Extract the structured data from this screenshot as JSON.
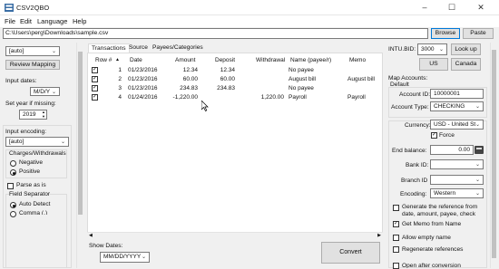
{
  "window": {
    "title": "CSV2QBO"
  },
  "menu": [
    "File",
    "Edit",
    "Language",
    "Help"
  ],
  "file": {
    "path": "C:\\Users\\perg\\Downloads\\sample.csv",
    "browse_label": "Browse",
    "paste_label": "Paste"
  },
  "left": {
    "template_value": "[auto]",
    "review_mapping_label": "Review Mapping",
    "input_dates_label": "Input dates:",
    "date_format_value": "M/D/Y",
    "set_year_label": "Set year if missing:",
    "year_value": "2019",
    "input_encoding_label": "Input encoding:",
    "encoding_value": "[auto]",
    "charges_label": "Charges/Withdrawals",
    "negative_label": "Negative",
    "positive_label": "Positive",
    "parse_as_is_label": "Parse as is",
    "field_separator_label": "Field Separator",
    "auto_detect_label": "Auto Detect",
    "comma_label": "Comma (,)"
  },
  "tabs": [
    "Transactions",
    "Source",
    "Payees/Categories"
  ],
  "table": {
    "headers": [
      "Row #",
      "Date",
      "Amount",
      "Deposit",
      "Withdrawal",
      "Name (payee/r)",
      "Memo"
    ],
    "rows": [
      {
        "num": "1",
        "date": "01/23/2016",
        "amount": "12.34",
        "deposit": "12.34",
        "withdrawal": "",
        "name": "No payee",
        "memo": ""
      },
      {
        "num": "2",
        "date": "01/23/2016",
        "amount": "60.00",
        "deposit": "60.00",
        "withdrawal": "",
        "name": "August bill",
        "memo": "August bill"
      },
      {
        "num": "3",
        "date": "01/23/2016",
        "amount": "234.83",
        "deposit": "234.83",
        "withdrawal": "",
        "name": "No payee",
        "memo": ""
      },
      {
        "num": "4",
        "date": "01/24/2016",
        "amount": "-1,220.00",
        "deposit": "",
        "withdrawal": "1,220.00",
        "name": "Payroll",
        "memo": "Payroll"
      }
    ]
  },
  "bottom": {
    "show_dates_label": "Show Dates:",
    "show_dates_value": "MM/DD/YYYY",
    "convert_label": "Convert"
  },
  "right": {
    "intu_bid_label": "INTU.BID:",
    "intu_bid_value": "3000",
    "lookup_label": "Look up",
    "us_label": "US",
    "canada_label": "Canada",
    "map_accounts_label": "Map Accounts:",
    "default_label": "Default",
    "account_id_label": "Account ID:",
    "account_id_value": "10000001",
    "account_type_label": "Account Type:",
    "account_type_value": "CHECKING",
    "currency_label": "Currency:",
    "currency_value": "USD - United Sta",
    "force_label": "Force",
    "end_balance_label": "End balance:",
    "end_balance_value": "0.00",
    "bank_id_label": "Bank ID:",
    "branch_id_label": "Branch ID",
    "encoding_label": "Encoding:",
    "encoding_value": "Western",
    "generate_ref_label": "Generate the reference from date, amount, payee, check",
    "get_memo_label": "Get Memo from Name",
    "allow_empty_label": "Allow empty name",
    "regenerate_label": "Regenerate references",
    "open_after_label": "Open after conversion"
  }
}
